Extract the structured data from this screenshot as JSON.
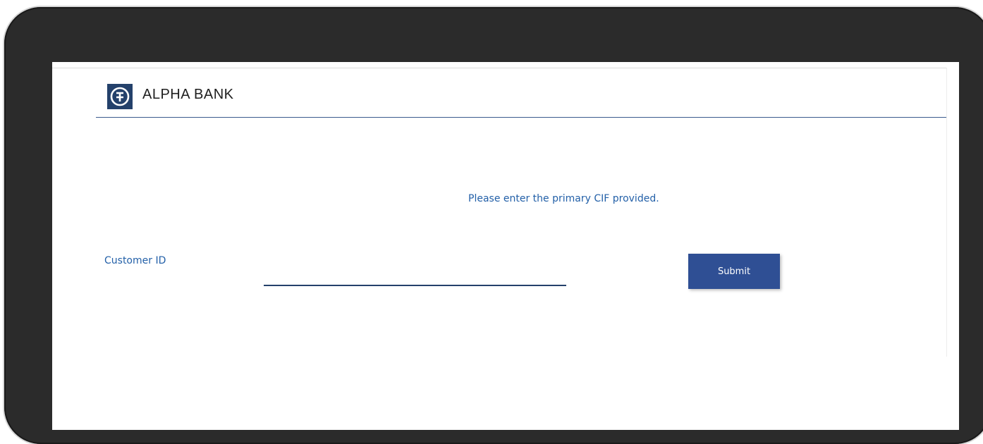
{
  "brand": {
    "name": "ALPHA BANK",
    "logo_icon": "alpha-bank-logo-icon",
    "color": "#24416b"
  },
  "form": {
    "instruction": "Please enter the primary CIF provided.",
    "customer_id_label": "Customer ID",
    "customer_id_value": "",
    "submit_label": "Submit"
  },
  "colors": {
    "accent_text": "#2360a8",
    "button": "#2f4f94",
    "device_frame": "#2b2b2b"
  }
}
